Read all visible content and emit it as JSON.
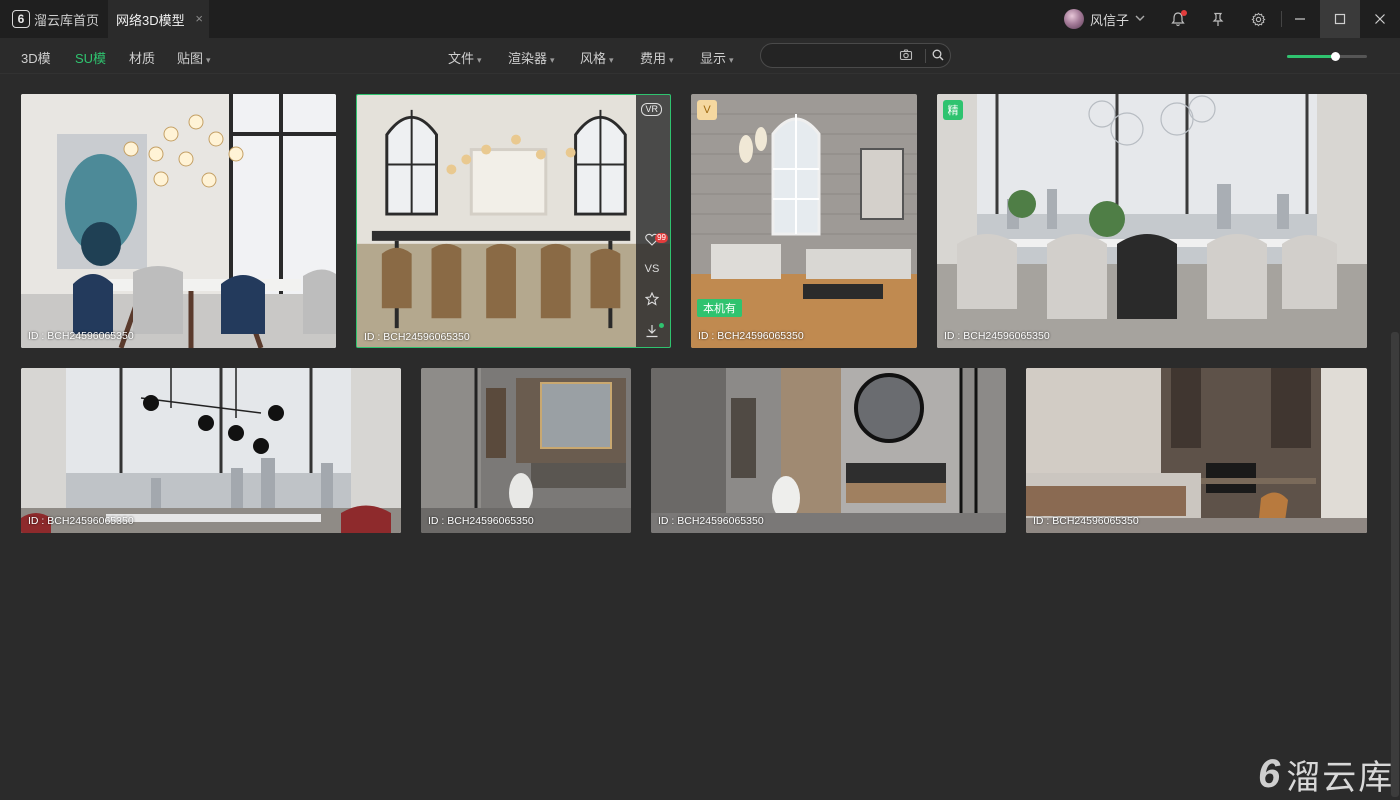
{
  "titlebar": {
    "home_tab": "溜云库首页",
    "home_logo": "6",
    "active_tab": "网络3D模型",
    "close_glyph": "×",
    "user_name": "风信子"
  },
  "toolbar": {
    "categories": [
      "3D模",
      "SU模",
      "材质",
      "贴图"
    ],
    "active_category": "SU模",
    "filters": [
      "文件",
      "渲染器",
      "风格",
      "费用",
      "显示"
    ],
    "search_placeholder": "",
    "zoom_fraction": 0.6
  },
  "cards": [
    {
      "id": "ID : BCH24596065350"
    },
    {
      "id": "ID : BCH24596065350",
      "vr": "VR",
      "like_count": "99",
      "vs": "VS"
    },
    {
      "id": "ID : BCH24596065350",
      "tag": "V",
      "local_label": "本机有"
    },
    {
      "id": "ID : BCH24596065350",
      "tag": "精"
    },
    {
      "id": "ID : BCH24596065350"
    },
    {
      "id": "ID : BCH24596065350"
    },
    {
      "id": "ID : BCH24596065350"
    },
    {
      "id": "ID : BCH24596065350"
    }
  ],
  "brand": {
    "logo_glyph": "6",
    "name": "溜云库"
  },
  "colors": {
    "accent": "#2fc36f",
    "background": "#2b2b2b",
    "titlebar": "#1f1f1f",
    "notify": "#e23c3c"
  }
}
